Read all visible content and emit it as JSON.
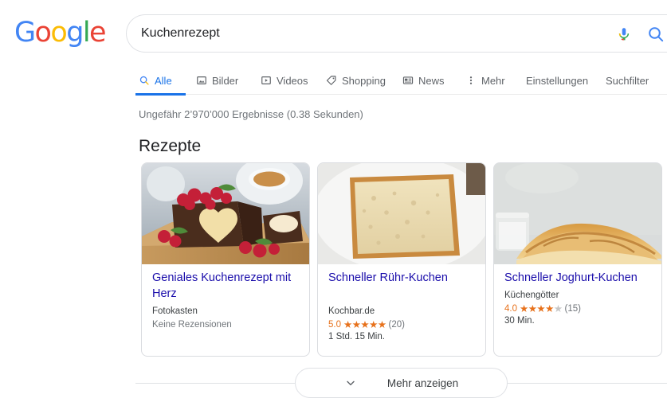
{
  "brand": {
    "name": "Google",
    "letters": [
      {
        "ch": "G",
        "color": "#4285f4"
      },
      {
        "ch": "o",
        "color": "#ea4335"
      },
      {
        "ch": "o",
        "color": "#fbbc05"
      },
      {
        "ch": "g",
        "color": "#4285f4"
      },
      {
        "ch": "l",
        "color": "#34a853"
      },
      {
        "ch": "e",
        "color": "#ea4335"
      }
    ]
  },
  "search": {
    "query": "Kuchenrezept",
    "placeholder": "",
    "mic_icon": "microphone-icon",
    "search_icon": "search-icon"
  },
  "nav": {
    "tabs": [
      {
        "label": "Alle",
        "icon": "search-icon",
        "active": true
      },
      {
        "label": "Bilder",
        "icon": "image-icon",
        "active": false
      },
      {
        "label": "Videos",
        "icon": "video-icon",
        "active": false
      },
      {
        "label": "Shopping",
        "icon": "tag-icon",
        "active": false
      },
      {
        "label": "News",
        "icon": "news-icon",
        "active": false
      },
      {
        "label": "Mehr",
        "icon": "more-vertical-icon",
        "active": false
      }
    ],
    "links": [
      {
        "label": "Einstellungen"
      },
      {
        "label": "Suchfilter"
      }
    ]
  },
  "results": {
    "stats": "Ungefähr 2’970’000 Ergebnisse (0.38 Sekunden)",
    "section_title": "Rezepte"
  },
  "cards": [
    {
      "title": "Geniales Kuchenrezept mit Herz",
      "source": "Fotokasten",
      "reviews_text": "Keine Rezensionen",
      "rating": null,
      "rating_count": null,
      "time": null,
      "image_alt": "chocolate-loaf-cake-with-heart-center"
    },
    {
      "title": "Schneller Rühr-Kuchen",
      "source": "Kochbar.de",
      "reviews_text": null,
      "rating": "5.0",
      "stars_filled": 5,
      "stars_total": 5,
      "rating_count": "(20)",
      "time": "1 Std. 15 Min.",
      "image_alt": "sponge-cake-slice-on-white-plate"
    },
    {
      "title": "Schneller Joghurt-Kuchen",
      "source": "Küchengötter",
      "reviews_text": null,
      "rating": "4.0",
      "stars_filled": 4,
      "stars_total": 5,
      "rating_count": "(15)",
      "time": "30 Min.",
      "image_alt": "yogurt-cake-with-glass-jar"
    }
  ],
  "show_more": {
    "label": "Mehr anzeigen",
    "icon": "chevron-down-icon"
  },
  "colors": {
    "accent_blue": "#1a73e8",
    "link_blue": "#1a0dab",
    "rating_orange": "#e7711b",
    "muted_gray": "#70757a",
    "border_gray": "#dadce0"
  }
}
